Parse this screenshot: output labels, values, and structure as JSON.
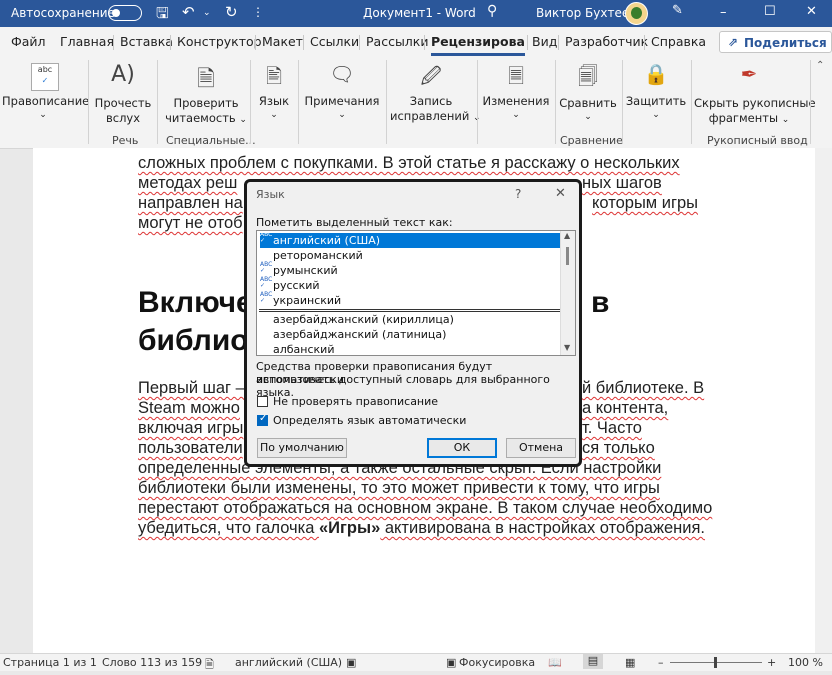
{
  "titlebar": {
    "autosave_label": "Автосохранение",
    "doc_title": "Документ1 - Word",
    "user_name": "Виктор Бухтеев",
    "bg_color": "#2b579a"
  },
  "tabs": [
    "Файл",
    "Главная",
    "Вставка",
    "Конструктор",
    "Макет",
    "Ссылки",
    "Рассылки",
    "Рецензирован",
    "Вид",
    "Разработчик",
    "Справка"
  ],
  "active_tab": "Рецензирован",
  "share_label": "Поделиться",
  "ribbon": {
    "spelling": "Правописание",
    "read1": "Прочесть",
    "read2": "вслух",
    "check1": "Проверить",
    "check2": "читаемость",
    "lang": "Язык",
    "notes": "Примечания",
    "track1": "Запись",
    "track2": "исправлений",
    "changes": "Изменения",
    "compare": "Сравнить",
    "protect": "Защитить",
    "hide1": "Скрыть рукописные",
    "hide2": "фрагменты",
    "group_speech": "Речь",
    "group_special": "Специальные...",
    "group_compare": "Сравнение",
    "group_ink": "Рукописный ввод"
  },
  "document": {
    "l1": "сложных проблем с покупками. В этой статье я расскажу о нескольких",
    "l2a": "методах реш",
    "l2b": "ных шагов",
    "l3a": "направлен на",
    "l3b": "которым игры",
    "l4a": "могут не отоб",
    "h1a": "Включе",
    "h1b": "в",
    "h2a": "библио",
    "p1a": "Первый шаг –",
    "p1b": "й библиотеке. В",
    "p2a": "Steam можно",
    "p2b": "а контента,",
    "p3a": "включая игры",
    "p3b": "т. Часто",
    "p4a": "пользователи",
    "p4b": "ся только",
    "p5": "определенные элементы, а также остальные скрыт. Если настройки",
    "p6": "библиотеки были изменены, то это может привести к тому, что игры",
    "p7": "перестают отображаться на основном экране. В таком случае необходимо",
    "p8a": "убедиться, что галочка ",
    "p8b": "«Игры»",
    "p8c": " активирована в настройках отображения."
  },
  "dialog": {
    "title": "Язык",
    "help": "?",
    "close": "✕",
    "mark_label": "Пометить выделенный текст как:",
    "languages": [
      {
        "name": "английский (США)",
        "check": true,
        "selected": true
      },
      {
        "name": "ретороманский",
        "check": false,
        "selected": false
      },
      {
        "name": "румынский",
        "check": true,
        "selected": false
      },
      {
        "name": "русский",
        "check": true,
        "selected": false
      },
      {
        "name": "украинский",
        "check": true,
        "selected": false
      },
      {
        "name": "азербайджанский (кириллица)",
        "check": false,
        "selected": false
      },
      {
        "name": "азербайджанский (латиница)",
        "check": false,
        "selected": false
      },
      {
        "name": "албанский",
        "check": false,
        "selected": false
      }
    ],
    "info1": "Средства проверки правописания будут автоматически",
    "info2": "использовать доступный словарь для выбранного языка.",
    "no_check": "Не проверять правописание",
    "auto_detect": "Определять язык автоматически",
    "no_check_on": false,
    "auto_detect_on": true,
    "default_btn": "По умолчанию",
    "ok_btn": "ОК",
    "cancel_btn": "Отмена"
  },
  "status": {
    "page": "Страница 1 из 1",
    "words": "Слово 113 из 159",
    "lang": "английский (США)",
    "focus": "Фокусировка",
    "zoom": "100 %"
  }
}
